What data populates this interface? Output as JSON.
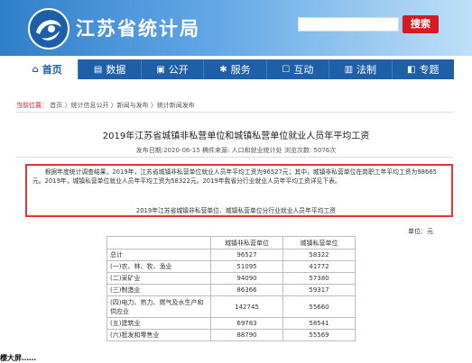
{
  "header": {
    "site_name": "江苏省统计局",
    "search_label": "搜索"
  },
  "nav": [
    {
      "label": "首页",
      "icon": "home-icon",
      "active": true
    },
    {
      "label": "数据",
      "icon": "data-icon",
      "active": false
    },
    {
      "label": "公开",
      "icon": "document-icon",
      "active": false
    },
    {
      "label": "服务",
      "icon": "gear-icon",
      "active": false
    },
    {
      "label": "互动",
      "icon": "chat-icon",
      "active": false
    },
    {
      "label": "法制",
      "icon": "law-icon",
      "active": false
    },
    {
      "label": "专题",
      "icon": "topic-icon",
      "active": false
    }
  ],
  "breadcrumb": {
    "label": "当前位置",
    "path": "首页 〉统计信息公开 〉新闻与发布 〉统计新闻发布"
  },
  "article": {
    "title": "2019年江苏省城镇非私营单位和城镇私营单位就业人员年平均工资",
    "meta": "发布日期:2020-06-15   稿件来源: 人口和就业统计处    浏览次数: 5076次",
    "paragraph": "根据年度统计调查结果，2019年，江苏省城镇非私营单位就业人员年平均工资为96527元；其中，城镇非私营单位在岗职工年平均工资为98665元。2019年，城镇私营单位就业人员年平均工资为58322元。2019年我省分行业就业人员年平均工资详见下表。",
    "table_caption": "2019年江苏省城镇非私营单位、城镇私营单位分行业就业人员年平均工资",
    "unit": "单位：元"
  },
  "table": {
    "headers": [
      "",
      "城镇非私营单位",
      "城镇私营单位"
    ],
    "rows": [
      {
        "label": "总计",
        "non_private": "96527",
        "private": "58322"
      },
      {
        "label": "(一)农、林、牧、渔业",
        "non_private": "51095",
        "private": "41772"
      },
      {
        "label": "(二)采矿业",
        "non_private": "94090",
        "private": "57380"
      },
      {
        "label": "(三)制造业",
        "non_private": "86366",
        "private": "59317"
      },
      {
        "label": "(四)电力、热力、燃气及水生产和供应业",
        "non_private": "142745",
        "private": "55660"
      },
      {
        "label": "(五)建筑业",
        "non_private": "69783",
        "private": "58541"
      },
      {
        "label": "(六)批发和零售业",
        "non_private": "88790",
        "private": "55569"
      }
    ]
  },
  "bottom_text": "樱大屏……"
}
